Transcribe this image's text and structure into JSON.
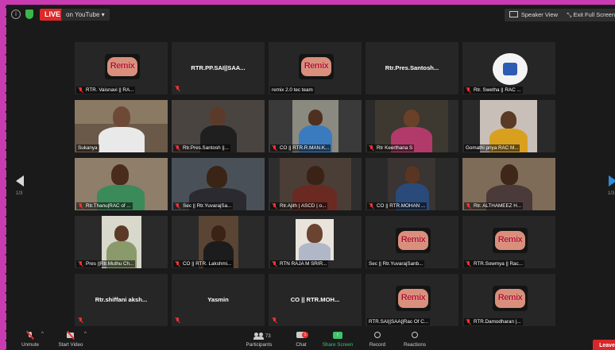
{
  "topbar": {
    "live": "LIVE",
    "youtube": "on YouTube",
    "speaker_view": "Speaker View",
    "exit_full": "Exit Full Screen"
  },
  "pagination": {
    "left": "1/3",
    "right": "1/3"
  },
  "tiles": {
    "r1": [
      "RTR. Vaisnavi || RA...",
      "RTR.PP.SAI||SAA...",
      "remix 2.0 tec team",
      "Rtr.Pres.Santosh...",
      "Rtr. Swetha || RAC ..."
    ],
    "r2": [
      "Sukanya",
      "Rtr.Pres.Santosh ||...",
      "CO || RTR.R.MAN.K...",
      "Rtr Keerthana S",
      "Gomathi priya RAC M..."
    ],
    "r3": [
      "Rtr.Thanu|RAC of ...",
      "Sec || Rtr.YuvarajSa...",
      "Rtr.Ajith | ASCD | o...",
      "CO || RTR.MOHAN ...",
      "Rtr. ALTHAMEEZ H..."
    ],
    "r4": [
      "Pres ||Rtr.Muthu Ch...",
      "CO || RTR. Lakshmi...",
      "RTN RAJA M SRIR...",
      "Sec || Rtr.YuvarajSanb...",
      "RTR.Sowmya || Rac..."
    ],
    "r5": [
      "Rtr.shiffani aksh...",
      "Yasmin",
      "CO || RTR.MOH...",
      "RTR.SAI||SAA||Rac Of C...",
      "RTR.Damodharan |..."
    ]
  },
  "remix_text": "Remix",
  "toolbar": {
    "unmute": "Unmute",
    "start_video": "Start Video",
    "participants": "Participants",
    "participants_count": "73",
    "chat": "Chat",
    "chat_badge": "1",
    "share_screen": "Share Screen",
    "record": "Record",
    "reactions": "Reactions",
    "leave": "Leave"
  },
  "colors": {
    "frame": "#c93bb0",
    "active_border": "#c9e86a",
    "share": "#3cc46a",
    "leave": "#d7272a"
  }
}
